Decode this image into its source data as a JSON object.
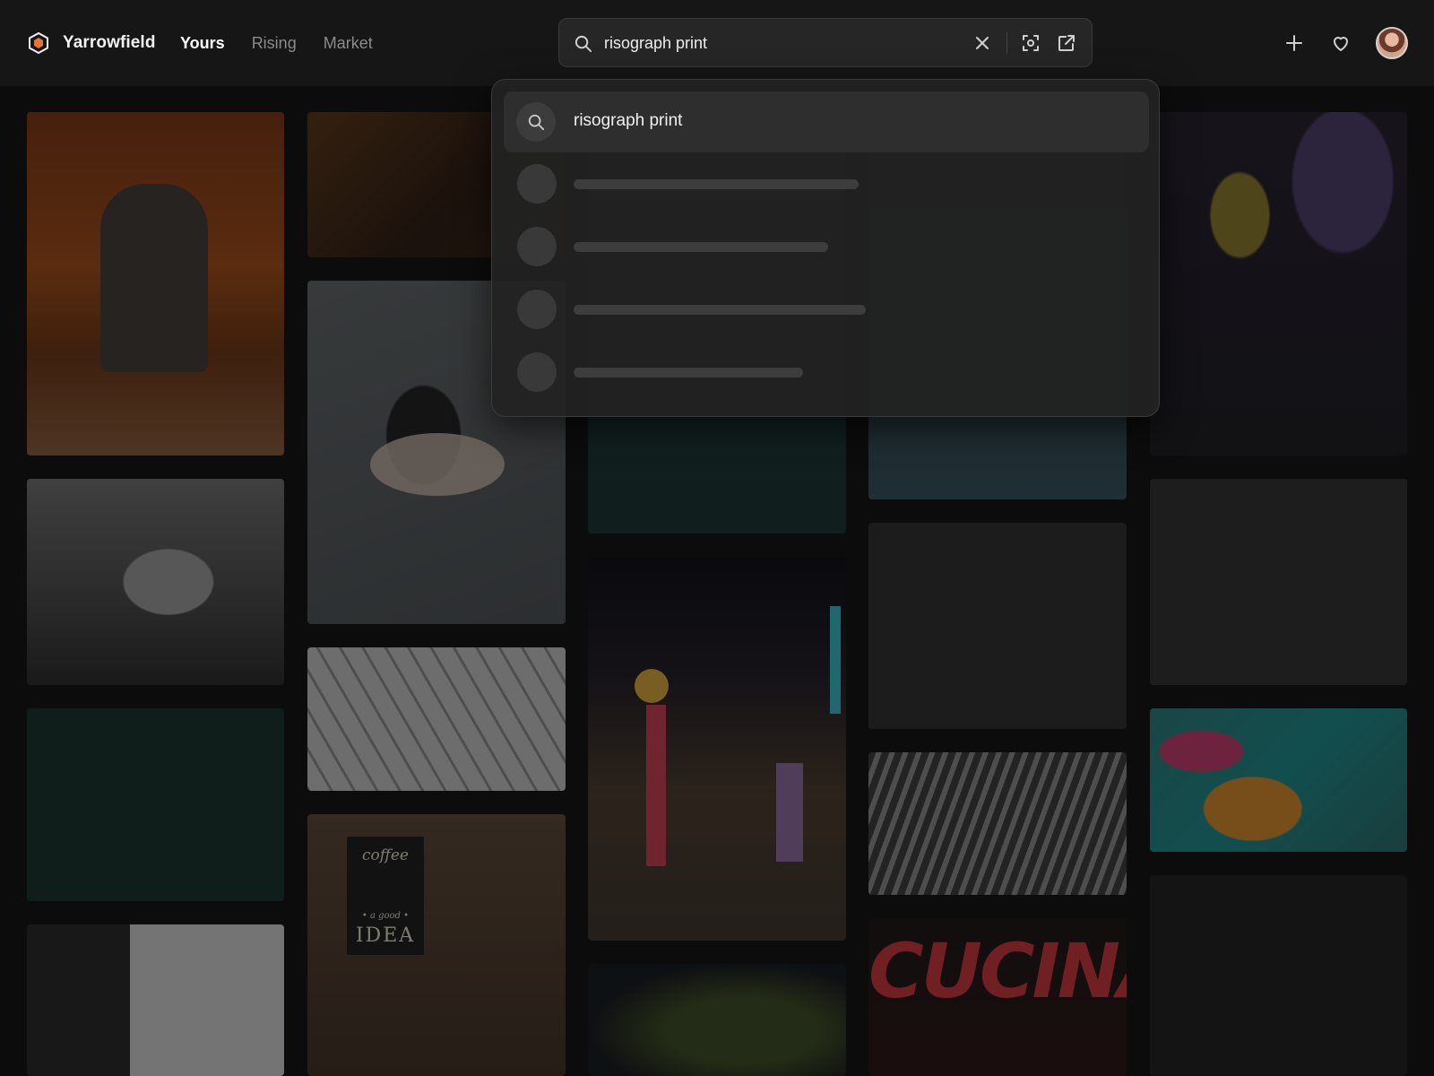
{
  "brand": {
    "name": "Yarrowfield"
  },
  "nav": {
    "items": [
      {
        "label": "Yours",
        "active": true
      },
      {
        "label": "Rising",
        "active": false
      },
      {
        "label": "Market",
        "active": false
      }
    ]
  },
  "search": {
    "value": "risograph print"
  },
  "suggestions": {
    "items": [
      {
        "text": "risograph print"
      }
    ],
    "loading_rows": 4
  },
  "tiles": {
    "coffee_sign": {
      "top": "coffee",
      "mid": "• a good •",
      "bottom": "IDEA"
    },
    "cucina_sign": "CUCINA"
  },
  "icons": {
    "search": "search-icon",
    "clear": "close-icon",
    "scan": "visual-search-icon",
    "open": "open-external-icon",
    "add": "plus-icon",
    "like": "heart-icon"
  },
  "colors": {
    "background": "#0f0f0f",
    "header": "#161616",
    "dropdown": "#222222",
    "logo_accent": "#e2733a"
  }
}
